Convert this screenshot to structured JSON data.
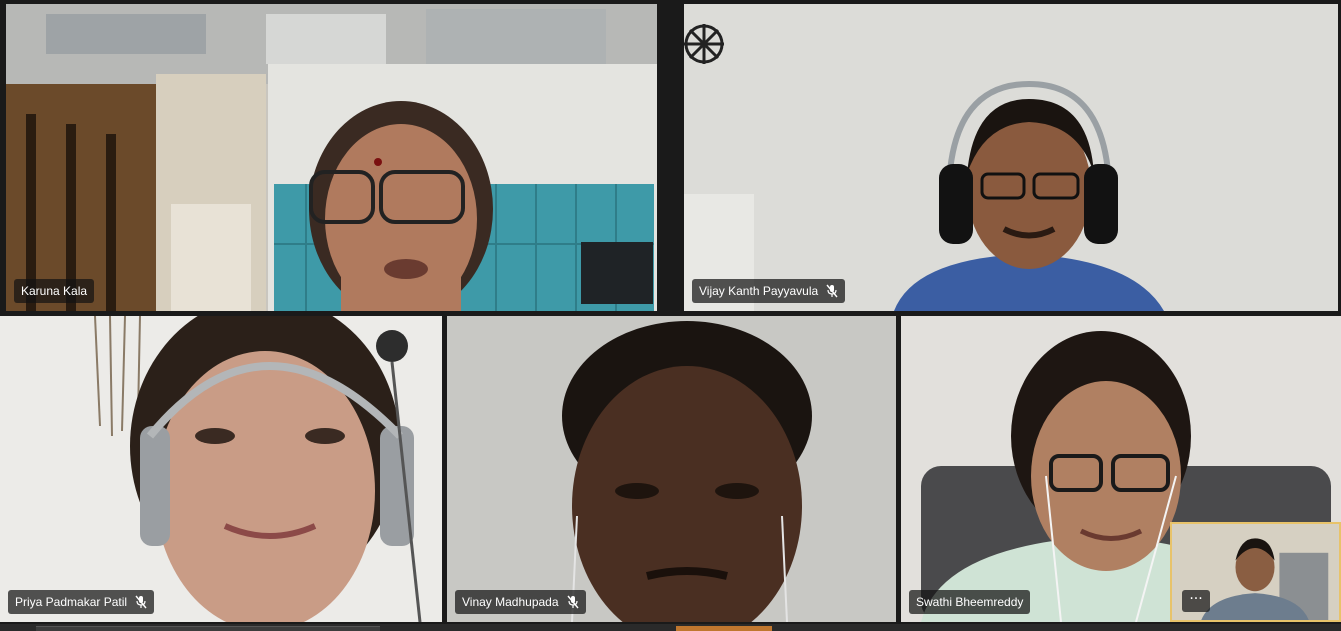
{
  "participants": [
    {
      "name": "Karuna Kala",
      "muted": false,
      "active_speaker": true
    },
    {
      "name": "Vijay Kanth Payyavula",
      "muted": true,
      "active_speaker": false
    },
    {
      "name": "Priya Padmakar Patil",
      "muted": true,
      "active_speaker": false
    },
    {
      "name": "Vinay Madhupada",
      "muted": true,
      "active_speaker": false
    },
    {
      "name": "Swathi Bheemreddy",
      "muted": false,
      "active_speaker": false
    }
  ],
  "self_view": {
    "more_label": "···"
  },
  "colors": {
    "active_speaker_border": "#8c8fe8",
    "self_view_border": "#e8c36a",
    "name_tag_bg": "#141414"
  },
  "icons": {
    "mic_muted": "mic-muted-icon"
  }
}
